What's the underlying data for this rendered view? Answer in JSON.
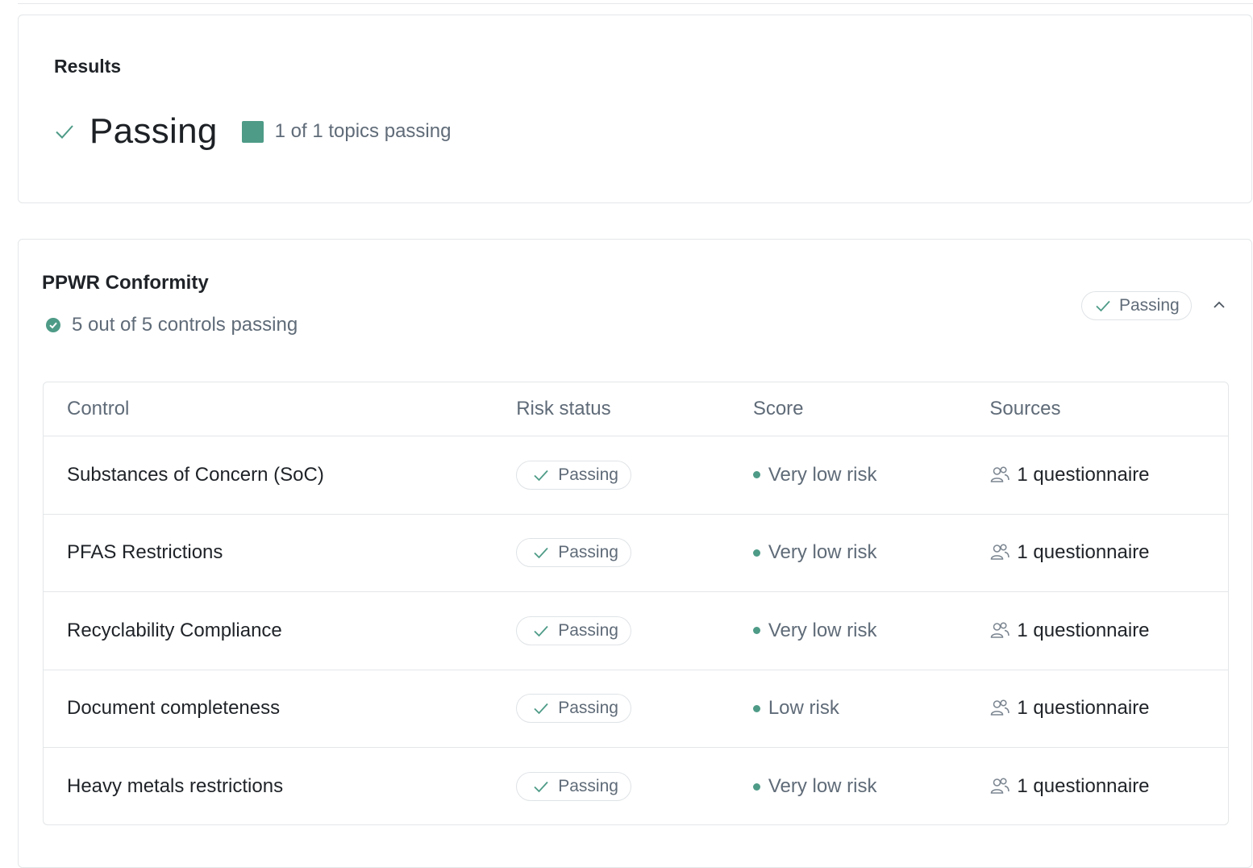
{
  "results": {
    "title": "Results",
    "status": "Passing",
    "topics_text": "1 of 1 topics passing"
  },
  "conformity": {
    "title": "PPWR Conformity",
    "subtitle": "5 out of 5 controls passing",
    "status_pill": "Passing",
    "table": {
      "headers": [
        "Control",
        "Risk status",
        "Score",
        "Sources"
      ],
      "rows": [
        {
          "control": "Substances of Concern (SoC)",
          "risk_status": "Passing",
          "score": "Very low risk",
          "sources": "1 questionnaire"
        },
        {
          "control": "PFAS Restrictions",
          "risk_status": "Passing",
          "score": "Very low risk",
          "sources": "1 questionnaire"
        },
        {
          "control": "Recyclability Compliance",
          "risk_status": "Passing",
          "score": "Very low risk",
          "sources": "1 questionnaire"
        },
        {
          "control": "Document completeness",
          "risk_status": "Passing",
          "score": "Low risk",
          "sources": "1 questionnaire"
        },
        {
          "control": "Heavy metals restrictions",
          "risk_status": "Passing",
          "score": "Very low risk",
          "sources": "1 questionnaire"
        }
      ]
    }
  },
  "colors": {
    "accent": "#4e9b87",
    "text_muted": "#5f6b78",
    "border": "#e3e6e8"
  },
  "icons": {
    "check": "check-icon",
    "ok": "check-circle-icon",
    "collapse": "chevron-up-icon",
    "sources": "users-icon"
  }
}
